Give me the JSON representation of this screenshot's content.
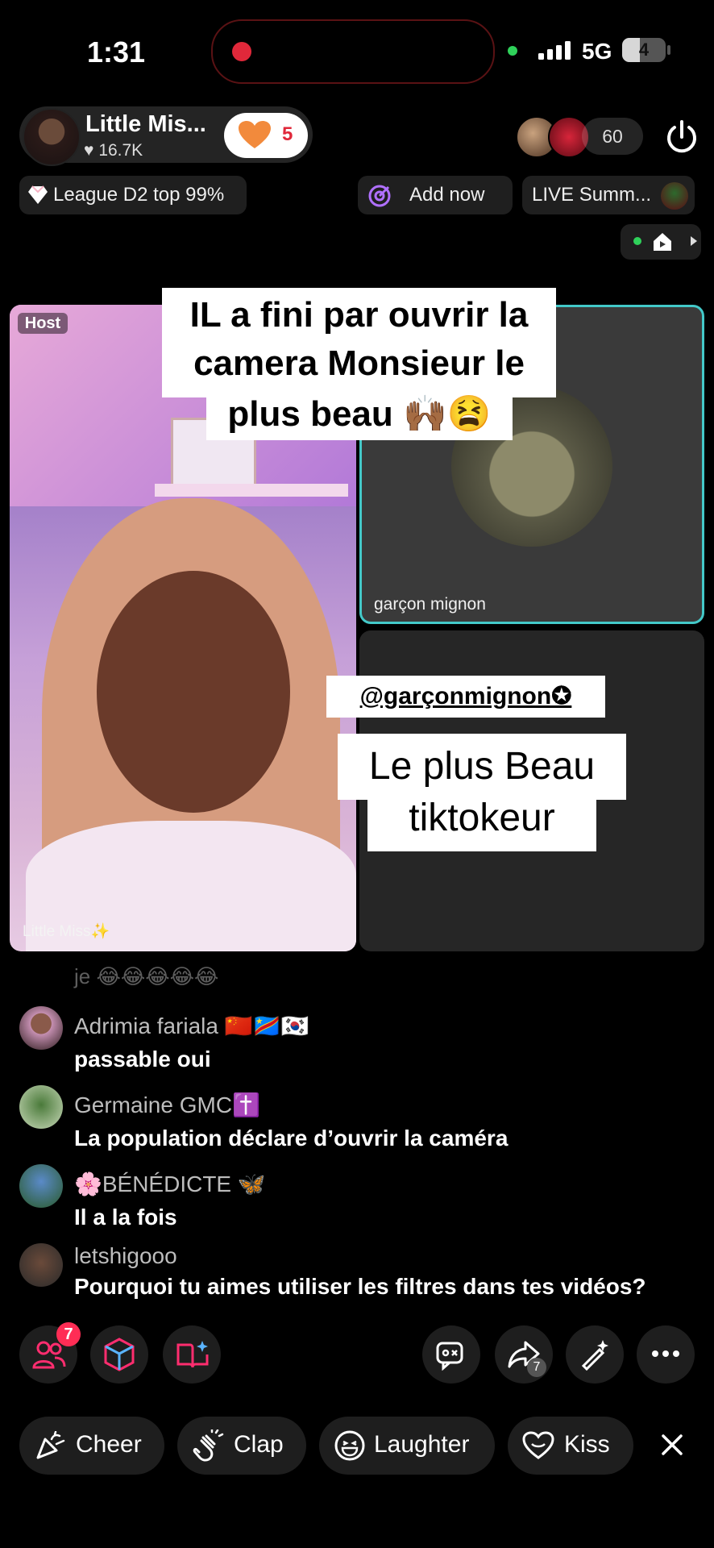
{
  "status_bar": {
    "time": "1:31",
    "network": "5G",
    "battery": "4",
    "battery_level": 0.4
  },
  "host": {
    "name": "Little Mis...",
    "likes": "16.7K",
    "follow_count": "5"
  },
  "viewers": {
    "count": "60"
  },
  "pills": {
    "league": "League D2 top 99%",
    "add_now": "Add now",
    "live_summit": "LIVE Summ..."
  },
  "video": {
    "host_badge": "Host",
    "host_label": "Little Miss✨",
    "guest_label": "garçon mignon"
  },
  "overlay_text": {
    "caption1": "IL a fini par ouvrir la camera Monsieur le",
    "caption2": "plus beau 🙌🏾😫",
    "mention": "@garçonmignon✪",
    "caption3": "Le plus Beau",
    "caption4": "tiktokeur"
  },
  "comments": {
    "partial": "je 😂😂😂😂😂",
    "items": [
      {
        "name": "Adrimia fariala 🇨🇳🇨🇩🇰🇷",
        "text": "passable oui"
      },
      {
        "name": "Germaine GMC✝️",
        "text": "La population déclare d’ouvrir la caméra"
      },
      {
        "name": "🌸BÉNÉDICTE 🦋",
        "text": "Il a la fois"
      },
      {
        "name": "letshigooo",
        "text": "Pourquoi tu aimes utiliser les filtres dans tes vidéos?"
      }
    ]
  },
  "toolbar": {
    "guests_badge": "7",
    "share_badge": "7"
  },
  "reactions": {
    "cheer": "Cheer",
    "clap": "Clap",
    "laughter": "Laughter",
    "kiss": "Kiss"
  },
  "colors": {
    "accent_pink": "#ff2d55",
    "guest_border": "#43c8c8",
    "follow_heart": "#f28a3c"
  }
}
